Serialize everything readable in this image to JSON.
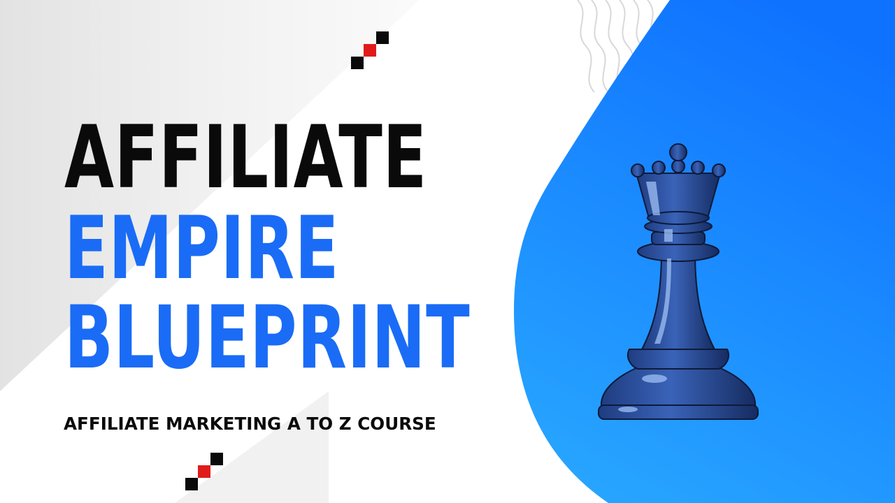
{
  "title": {
    "line1": "AFFILIATE",
    "line2": "EMPIRE",
    "line3": "BLUEPRINT"
  },
  "subtitle": "AFFILIATE MARKETING A TO Z COURSE",
  "colors": {
    "accent_blue": "#1a6cf6",
    "blob_top": "#0f72ff",
    "blob_bottom": "#27a4ff",
    "text_dark": "#0a0a0a",
    "pixel_red": "#e11b1b",
    "queen_body": "#2c4f9c",
    "queen_shadow": "#14254f"
  },
  "icons": {
    "queen": "chess-queen-icon",
    "pixels": "pixel-stair-icon",
    "waves": "wavy-lines-decoration"
  }
}
